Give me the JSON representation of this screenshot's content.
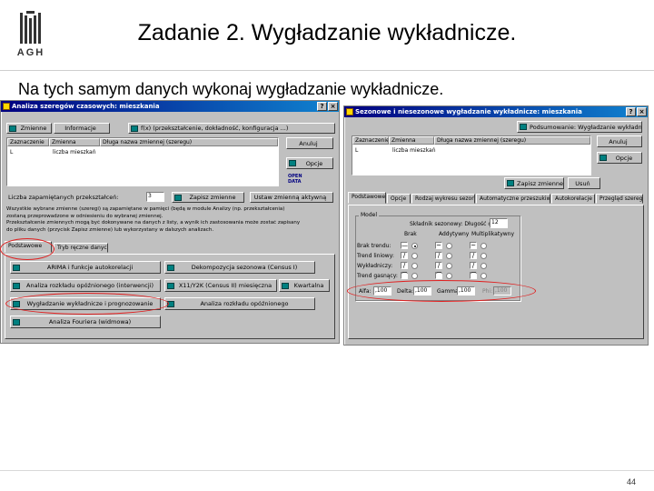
{
  "slide": {
    "title": "Zadanie 2. Wygładzanie wykładnicze.",
    "logo_text": "AGH",
    "instruction": "Na tych samym danych wykonaj wygładzanie wykładnicze.",
    "page_number": "44"
  },
  "left_window": {
    "title": "Analiza szeregów czasowych: mieszkania",
    "buttons": {
      "variables": "Zmienne",
      "info": "Informacje",
      "ok": "Anuluj",
      "options": "Opcje",
      "save": "Zapisz zmienne",
      "save_var": "Ustaw zmienną aktywną"
    },
    "info_bar": "f(x) (przekształcenie, dokładność, konfiguracja ...)",
    "variable_list": {
      "headers": [
        "Zaznaczenie",
        "Zmienna",
        "Długa nazwa zmiennej (szeregu)"
      ],
      "rows": [
        [
          "L",
          "liczba mieszkań",
          ""
        ]
      ]
    },
    "cases_label": "Liczba zapamiętanych przekształceń:",
    "cases_value": "3",
    "description": [
      "Wszystkie wybrane zmienne (szeregi) są zapamiętane w pamięci (będą w module Analizy (np. przekształcenia)",
      "zostaną przeprowadzone w odniesieniu do wybranej zmiennej.",
      "Przekształcenie zmiennych mogą być dokonywane na danych z listy, a wynik ich zastosowania może zostać zapisany",
      "do pliku danych (przycisk Zapisz zmienne) lub wykorzystany w dalszych analizach."
    ],
    "tabs": [
      "Podstawowe",
      "Tryb ręczne danych"
    ],
    "actions": [
      "ARIMA i funkcje autokorelacji",
      "Dekompozycja sezonowa (Census I)",
      "Analiza rozkładu opóźnionego (interwencji)",
      "X11/Y2K (Census II) miesięczna",
      "Kwartalna",
      "Wygładzanie wykładnicze i prognozowanie",
      "Analiza rozkładu opóźnionego",
      "Analiza Fouriera (widmowa)"
    ]
  },
  "right_window": {
    "title": "Sezonowe i niesezonowe wygładzanie wykładnicze: mieszkania",
    "buttons": {
      "summary": "Podsumowanie: Wygładzanie wykładnicze",
      "cancel": "Anuluj",
      "options": "Opcje",
      "save": "Zapisz zmienne",
      "exit": "Usuń"
    },
    "variable_list": {
      "headers": [
        "Zaznaczenie",
        "Zmienna",
        "Długa nazwa zmiennej (szeregu)"
      ],
      "rows": [
        [
          "L",
          "liczba mieszkań",
          ""
        ]
      ]
    },
    "tabs": [
      "Podstawowe",
      "Opcje",
      "Rodzaj wykresu sezonowości",
      "Automatyczne przeszukiwanie",
      "Autokorelacje",
      "Przegląd szeregu"
    ],
    "model": {
      "group_label": "Model",
      "season_label": "Składnik sezonowy: Długość cyklu:",
      "season_value": "12",
      "col_headers": [
        "Brak",
        "Addytywny",
        "Multiplikatywny"
      ],
      "row_labels": [
        "Brak trendu:",
        "Trend liniowy:",
        "Wykładniczy:",
        "Trend gasnący:"
      ],
      "params": [
        {
          "label": "Alfa:",
          "value": ",100"
        },
        {
          "label": "Delta:",
          "value": ",100"
        },
        {
          "label": "Gamma:",
          "value": ",100"
        },
        {
          "label": "Phi:",
          "value": ",100"
        }
      ]
    }
  },
  "colors": {
    "title_bar": "#000080",
    "window_bg": "#c0c0c0",
    "highlight": "#e02020"
  }
}
